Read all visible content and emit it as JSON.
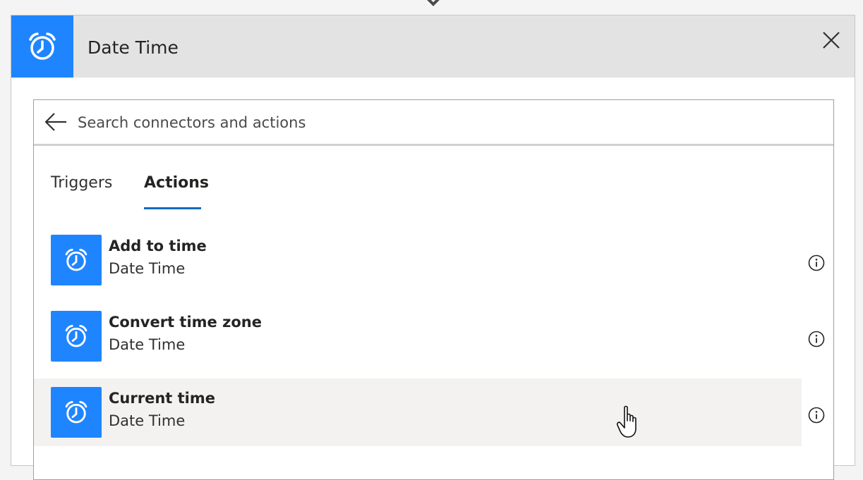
{
  "header": {
    "title": "Date Time",
    "icon": "alarm-clock-icon",
    "accent_color": "#1f85ff"
  },
  "search": {
    "placeholder": "Search connectors and actions",
    "value": ""
  },
  "tabs": [
    {
      "label": "Triggers",
      "selected": false
    },
    {
      "label": "Actions",
      "selected": true
    }
  ],
  "actions": [
    {
      "name": "Add to time",
      "connector": "Date Time",
      "icon": "alarm-clock-icon"
    },
    {
      "name": "Convert time zone",
      "connector": "Date Time",
      "icon": "alarm-clock-icon"
    },
    {
      "name": "Current time",
      "connector": "Date Time",
      "icon": "alarm-clock-icon",
      "hovered": true
    }
  ]
}
